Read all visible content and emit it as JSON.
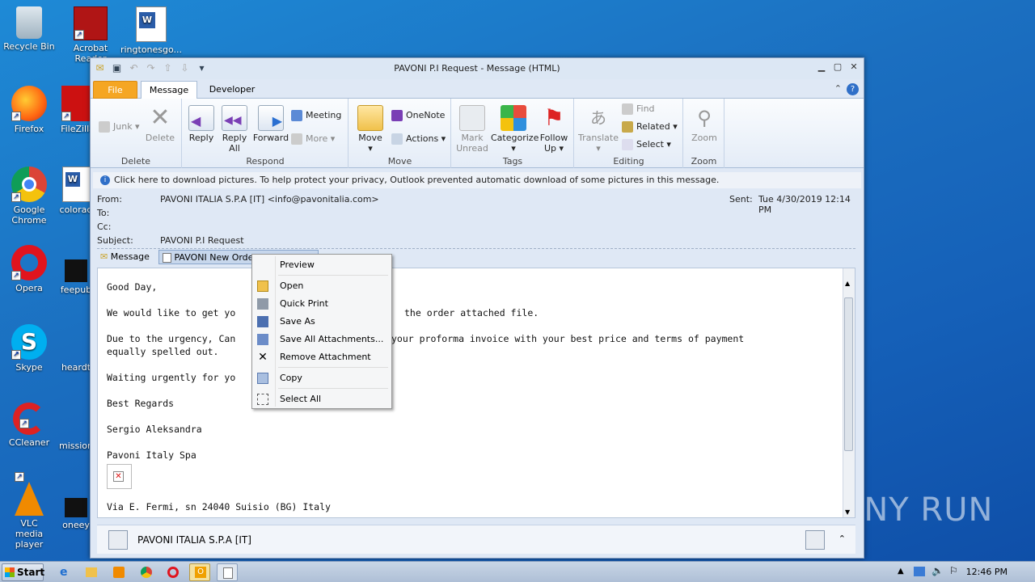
{
  "desktop": {
    "icons": [
      {
        "label": "Recycle Bin",
        "icon": "recycle-bin-icon"
      },
      {
        "label": "Acrobat Reader",
        "icon": "acrobat-icon"
      },
      {
        "label": "ringtonesgo...",
        "icon": "word-doc-icon"
      },
      {
        "label": "Firefox",
        "icon": "firefox-icon"
      },
      {
        "label": "FileZilla",
        "icon": "filezilla-icon"
      },
      {
        "label": "Google Chrome",
        "icon": "chrome-icon"
      },
      {
        "label": "coloraci",
        "icon": "word-doc-icon"
      },
      {
        "label": "Opera",
        "icon": "opera-icon"
      },
      {
        "label": "feepub",
        "icon": "file-icon"
      },
      {
        "label": "Skype",
        "icon": "skype-icon"
      },
      {
        "label": "heardt",
        "icon": "file-icon"
      },
      {
        "label": "CCleaner",
        "icon": "ccleaner-icon"
      },
      {
        "label": "mission",
        "icon": "file-icon"
      },
      {
        "label": "VLC media player",
        "icon": "vlc-icon"
      },
      {
        "label": "oneey",
        "icon": "file-icon"
      }
    ]
  },
  "window": {
    "title": "PAVONI P.I Request  -  Message (HTML)"
  },
  "tabs": {
    "file": "File",
    "message": "Message",
    "developer": "Developer"
  },
  "ribbon": {
    "delete": {
      "group": "Delete",
      "junk": "Junk",
      "delete": "Delete"
    },
    "respond": {
      "group": "Respond",
      "reply": "Reply",
      "reply_all_1": "Reply",
      "reply_all_2": "All",
      "forward": "Forward",
      "meeting": "Meeting",
      "more": "More"
    },
    "move": {
      "group": "Move",
      "move": "Move",
      "onenote": "OneNote",
      "actions": "Actions"
    },
    "tags": {
      "group": "Tags",
      "mark_1": "Mark",
      "mark_2": "Unread",
      "categorize": "Categorize",
      "follow_1": "Follow",
      "follow_2": "Up"
    },
    "editing": {
      "group": "Editing",
      "translate": "Translate",
      "find": "Find",
      "related": "Related",
      "select": "Select"
    },
    "zoom": {
      "group": "Zoom",
      "zoom": "Zoom"
    }
  },
  "infobar": "Click here to download pictures. To help protect your privacy, Outlook prevented automatic download of some pictures in this message.",
  "header": {
    "from_label": "From:",
    "from": "PAVONI ITALIA S.P.A [IT] <info@pavonitalia.com>",
    "to_label": "To:",
    "cc_label": "Cc:",
    "subject_label": "Subject:",
    "subject": "PAVONI P.I Request",
    "sent_label": "Sent:",
    "sent": "Tue 4/30/2019 12:14 PM"
  },
  "attachments": {
    "message_tab": "Message",
    "file_tab": "PAVONI New Orde"
  },
  "body": {
    "l1": "Good Day,",
    "l2a": "We would like to get yo",
    "l2b": "the order attached file.",
    "l3a": "Due to the urgency, Can",
    "l3b": "your proforma invoice with your best price and terms of payment",
    "l4": "equally spelled out.",
    "l5": "Waiting urgently for yo",
    "l6": "Best Regards",
    "l7": "Sergio Aleksandra",
    "l8": "Pavoni Italy Spa",
    "l9": "Via E. Fermi, sn 24040 Suisio (BG) Italy"
  },
  "people_pane": {
    "name": "PAVONI ITALIA S.P.A [IT]"
  },
  "context_menu": {
    "preview": "Preview",
    "open": "Open",
    "quick_print": "Quick Print",
    "save_as": "Save As",
    "save_all": "Save All Attachments...",
    "remove": "Remove Attachment",
    "copy": "Copy",
    "select_all": "Select All"
  },
  "taskbar": {
    "start": "Start",
    "clock": "12:46 PM"
  },
  "watermark": "ANY RUN"
}
